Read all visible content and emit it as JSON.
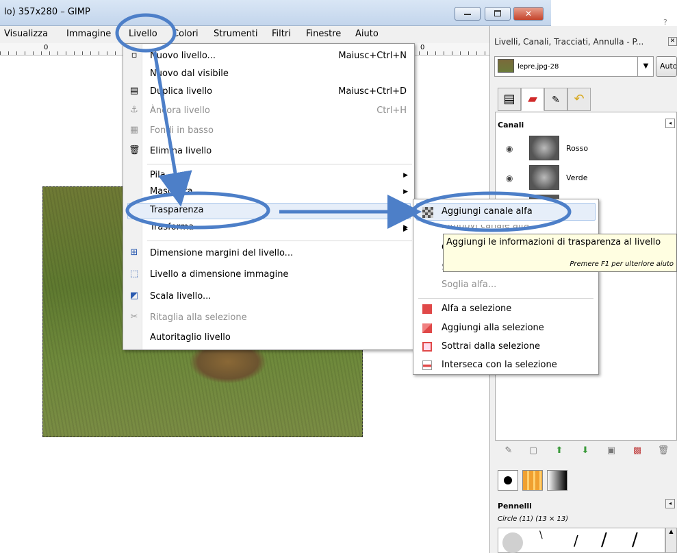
{
  "window": {
    "title": "lo) 357x280 – GIMP"
  },
  "menubar": [
    {
      "label": "Visualizza"
    },
    {
      "label": "Immagine"
    },
    {
      "label": "Livello"
    },
    {
      "label": "Colori"
    },
    {
      "label": "Strumenti"
    },
    {
      "label": "Filtri"
    },
    {
      "label": "Finestre"
    },
    {
      "label": "Aiuto"
    }
  ],
  "ruler": {
    "origin_label": "0"
  },
  "livello_menu": [
    {
      "label": "Nuovo livello...",
      "shortcut": "Maiusc+Ctrl+N",
      "icon": "new-layer-icon"
    },
    {
      "label": "Nuovo dal visibile",
      "icon": ""
    },
    {
      "label": "Duplica livello",
      "shortcut": "Maiusc+Ctrl+D",
      "icon": "duplicate-layer-icon"
    },
    {
      "label": "Àncora livello",
      "shortcut": "Ctrl+H",
      "disabled": true,
      "icon": "anchor-icon"
    },
    {
      "label": "Fondi in basso",
      "disabled": true,
      "icon": "merge-down-icon"
    },
    {
      "label": "Elimina livello",
      "icon": "trash-icon"
    },
    {
      "label": "Pila",
      "submenu": true
    },
    {
      "label": "Maschera",
      "submenu": true
    },
    {
      "label": "Trasparenza",
      "submenu": true,
      "highlighted": true
    },
    {
      "label": "Trasforma",
      "submenu": true
    },
    {
      "label": "Dimensione margini del livello...",
      "icon": "layer-boundary-icon"
    },
    {
      "label": "Livello a dimensione immagine",
      "icon": "layer-to-image-icon"
    },
    {
      "label": "Scala livello...",
      "icon": "scale-layer-icon"
    },
    {
      "label": "Ritaglia alla selezione",
      "disabled": true,
      "icon": "crop-icon"
    },
    {
      "label": "Autoritaglio livello"
    }
  ],
  "trasparenza_menu": [
    {
      "label": "Aggiungi canale alfa",
      "highlighted": true,
      "icon": "alpha-channel-icon"
    },
    {
      "label": "Rimuovi canale alfa"
    },
    {
      "label": "C"
    },
    {
      "label": "S"
    },
    {
      "label": "Soglia alfa...",
      "disabled": true
    },
    {
      "label": "Alfa a selezione",
      "icon": "alpha-to-selection-icon"
    },
    {
      "label": "Aggiungi alla selezione",
      "icon": "add-selection-icon"
    },
    {
      "label": "Sottrai dalla selezione",
      "icon": "subtract-selection-icon"
    },
    {
      "label": "Interseca con la selezione",
      "icon": "intersect-selection-icon"
    }
  ],
  "tooltip": {
    "text": "Aggiungi le informazioni di trasparenza al livello",
    "hint": "Premere F1 per ulteriore aiuto"
  },
  "dock": {
    "title": "Livelli, Canali, Tracciati, Annulla - P...",
    "image_select": "lepre.jpg-28",
    "auto_button": "Auto",
    "channels_header": "Canali",
    "channels": [
      {
        "name": "Rosso"
      },
      {
        "name": "Verde"
      }
    ],
    "brushes_header": "Pennelli",
    "brush_name": "Circle (11) (13 × 13)"
  },
  "colors": {
    "annotation": "#4d7fc8",
    "highlight": "#e6eef9",
    "tooltip_bg": "#fffee1"
  }
}
